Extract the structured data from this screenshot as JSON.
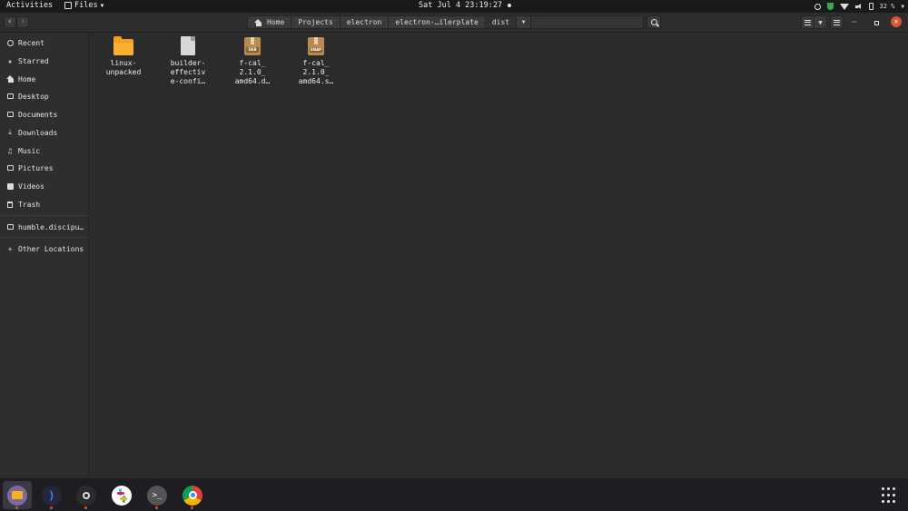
{
  "topbar": {
    "activities": "Activities",
    "app_name": "Files",
    "clock": "Sat Jul 4 23:19:27",
    "battery": "32 %"
  },
  "breadcrumbs": [
    "Home",
    "Projects",
    "electron",
    "electron-…ilerplate",
    "dist"
  ],
  "sidebar": {
    "items": [
      {
        "label": "Recent",
        "icon": "clock-icon"
      },
      {
        "label": "Starred",
        "icon": "star-icon"
      },
      {
        "label": "Home",
        "icon": "home-icon"
      },
      {
        "label": "Desktop",
        "icon": "desktop-icon"
      },
      {
        "label": "Documents",
        "icon": "documents-icon"
      },
      {
        "label": "Downloads",
        "icon": "downloads-icon"
      },
      {
        "label": "Music",
        "icon": "music-icon"
      },
      {
        "label": "Pictures",
        "icon": "pictures-icon"
      },
      {
        "label": "Videos",
        "icon": "videos-icon"
      },
      {
        "label": "Trash",
        "icon": "trash-icon"
      }
    ],
    "mounts": [
      {
        "label": "humble.discipu…",
        "icon": "drive-icon"
      }
    ],
    "other": {
      "label": "Other Locations",
      "icon": "plus-icon"
    }
  },
  "files": [
    {
      "name": "linux-\nunpacked",
      "type": "folder"
    },
    {
      "name": "builder-\neffectiv\ne-confi…",
      "type": "document"
    },
    {
      "name": "f-cal_\n2.1.0_\namd64.d…",
      "type": "package",
      "badge": "DEB"
    },
    {
      "name": "f-cal_\n2.1.0_\namd64.s…",
      "type": "package",
      "badge": "SNAP"
    }
  ],
  "dock": {
    "apps": [
      "files",
      "vscode",
      "steam",
      "slack",
      "terminal",
      "chrome"
    ],
    "accent_dot_color": "#e95420"
  }
}
